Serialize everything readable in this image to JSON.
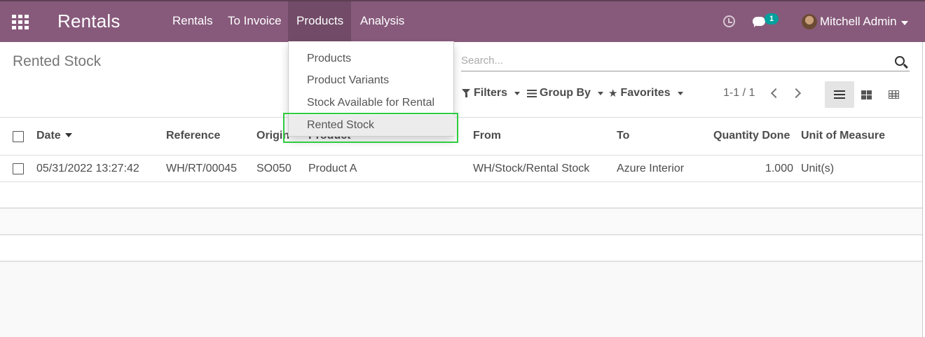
{
  "navbar": {
    "brand": "Rentals",
    "menus": [
      {
        "label": "Rentals"
      },
      {
        "label": "To Invoice"
      },
      {
        "label": "Products",
        "active": true
      },
      {
        "label": "Analysis"
      }
    ],
    "chat_badge": "1",
    "user_name": "Mitchell Admin",
    "icons": {
      "apps": "apps-grid-icon",
      "activity": "clock-icon",
      "messages": "chat-icon"
    },
    "colors": {
      "bar": "#875a7b",
      "active": "#714b67",
      "badge": "#00a09d"
    }
  },
  "dropdown": {
    "items": [
      "Products",
      "Product Variants",
      "Stock Available for Rental",
      "Rented Stock"
    ],
    "active_item": "Rented Stock",
    "highlight_color": "#2ecc40"
  },
  "control_panel": {
    "title": "Rented Stock",
    "search_placeholder": "Search...",
    "filters_label": "Filters",
    "groupby_label": "Group By",
    "favorites_label": "Favorites",
    "pager": "1-1 / 1",
    "views": [
      "list",
      "kanban",
      "pivot"
    ],
    "active_view": "list"
  },
  "table": {
    "columns": [
      "Date",
      "Reference",
      "Origin",
      "Product",
      "From",
      "To",
      "Quantity Done",
      "Unit of Measure"
    ],
    "sorted_column": "Date",
    "rows": [
      {
        "date": "05/31/2022 13:27:42",
        "reference": "WH/RT/00045",
        "origin": "SO050",
        "product": "Product A",
        "from": "WH/Stock/Rental Stock",
        "to": "Azure Interior",
        "quantity_done": "1.000",
        "uom": "Unit(s)"
      }
    ]
  }
}
